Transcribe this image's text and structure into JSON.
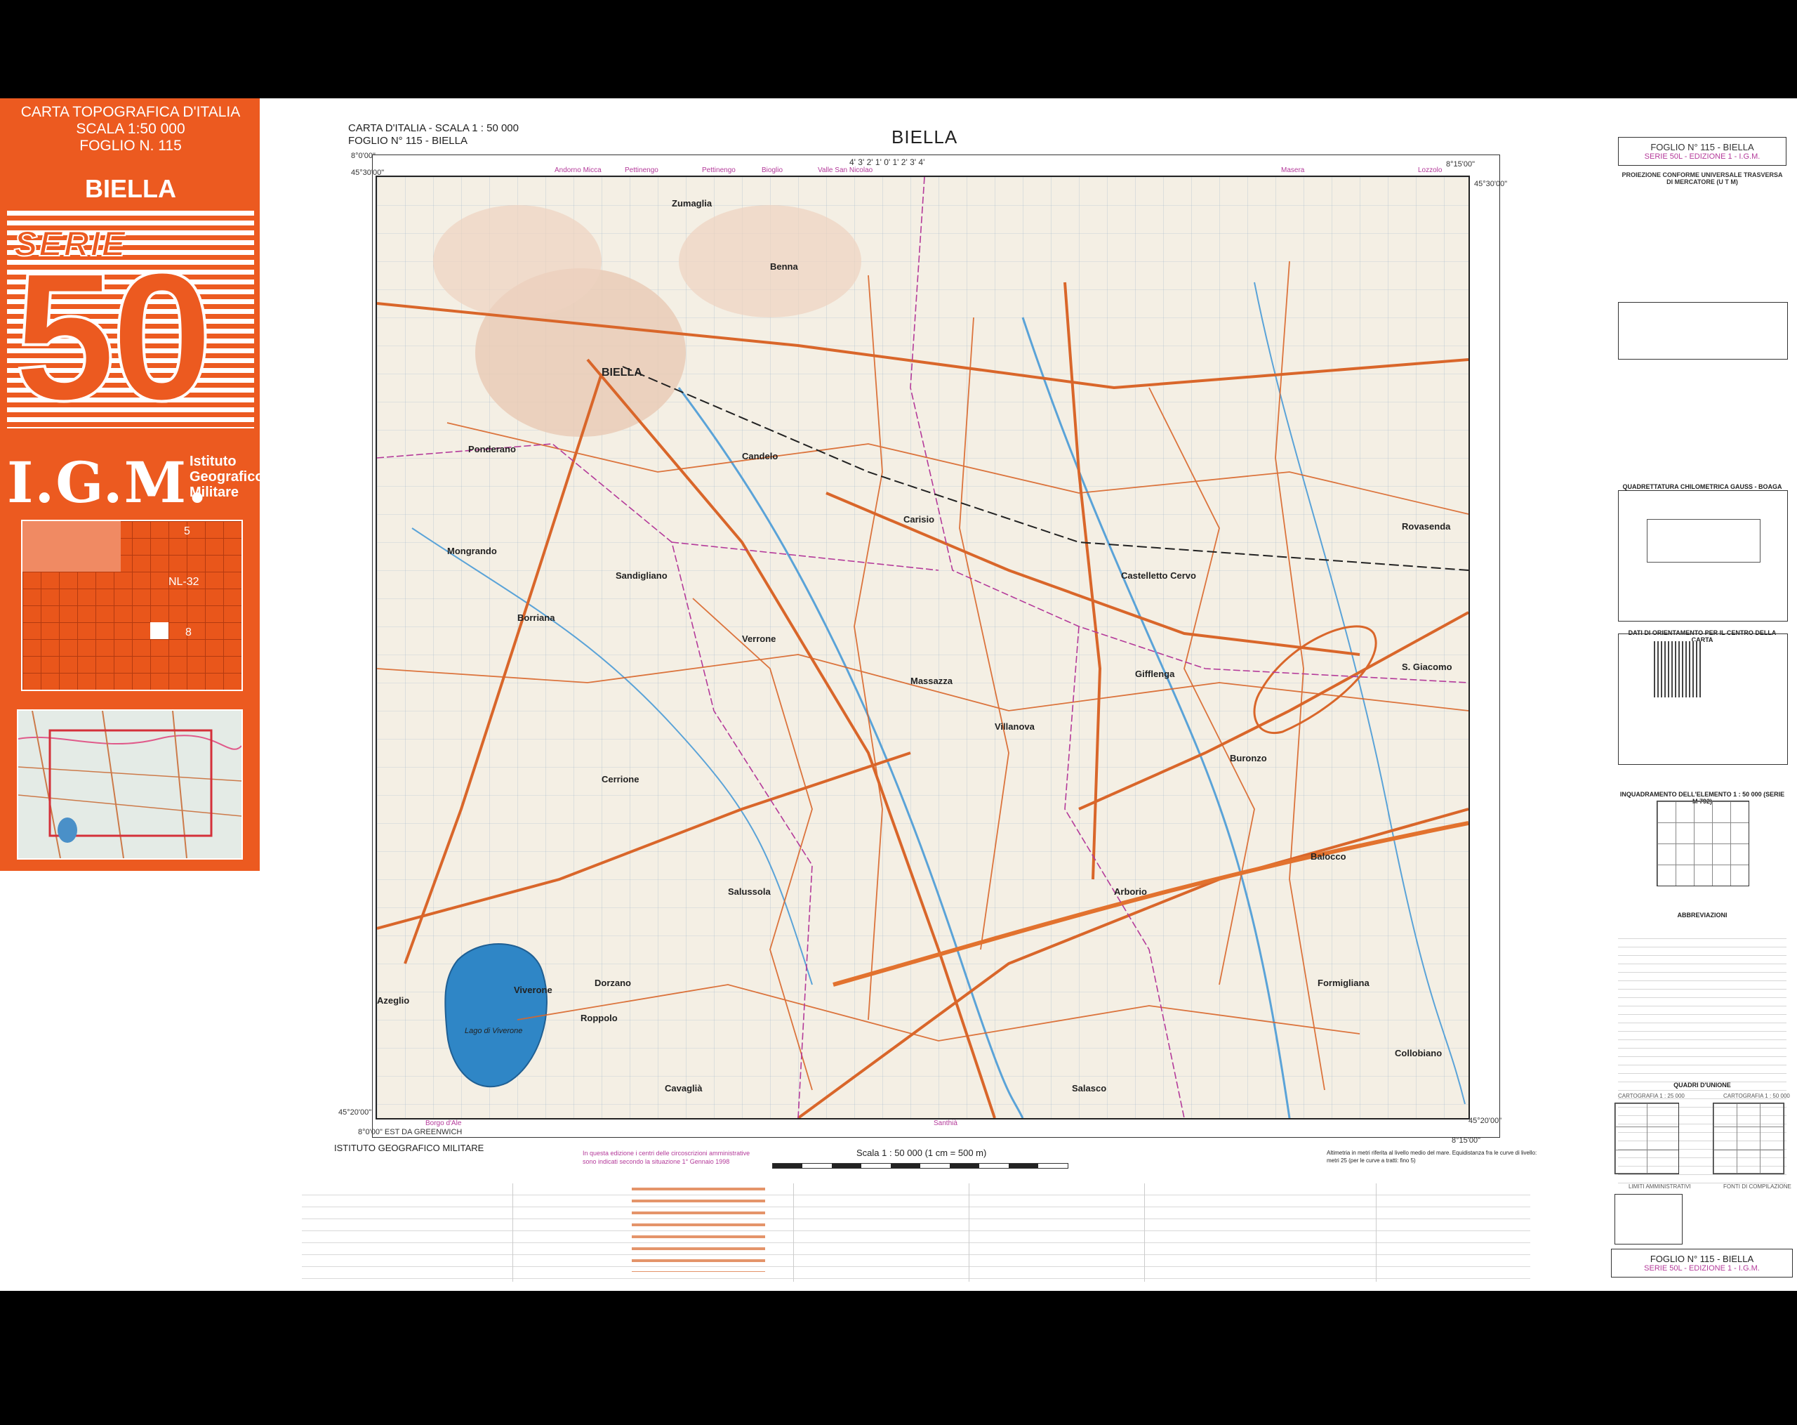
{
  "cover": {
    "line1": "CARTA TOPOGRAFICA D'ITALIA",
    "line2": "SCALA 1:50 000",
    "line3": "FOGLIO N. 115",
    "city": "BIELLA",
    "serie_word": "SERIE",
    "serie_number": "50",
    "logo": "I.G.M.",
    "institute_line1": "Istituto",
    "institute_line2": "Geografico",
    "institute_line3": "Militare",
    "index_label_5": "5",
    "index_label_nl32": "NL-32",
    "index_label_8": "8"
  },
  "header": {
    "left_line1": "CARTA D'ITALIA - SCALA 1 : 50 000",
    "left_line2": "FOGLIO N° 115 - BIELLA",
    "title": "BIELLA"
  },
  "map": {
    "corner_tl_lon": "8°0'00\"",
    "corner_tl_lat": "45°30'00\"",
    "corner_tr_lon": "8°15'00\"",
    "corner_tr_lat": "45°30'00\"",
    "corner_bl_lat": "45°20'00\"",
    "corner_bl_lon": "8°0'00\" EST DA GREENWICH",
    "corner_br_lat": "45°20'00\"",
    "corner_br_lon": "8°15'00\"",
    "top_scale": "4'  3'  2'  1'  0'  1'  2'  3'  4'",
    "edge_labels_top": [
      "Andorno Micca",
      "Pettinengo",
      "Pettinengo",
      "Bioglio",
      "Valle San Nicolao",
      "Masera",
      "Lozzolo"
    ],
    "edge_labels_bottom": [
      "Borgo d'Ale",
      "Santhià"
    ],
    "place_names": [
      "BIELLA",
      "Mongrando",
      "Candelo",
      "Sandigliano",
      "Cerrione",
      "Salussola",
      "Cavaglià",
      "Dorzano",
      "Roppolo",
      "Viverone",
      "Azeglio",
      "Lago di Viverone",
      "Massazza",
      "Villanova",
      "Buronzo",
      "Rovasenda",
      "S. Giacomo",
      "Balocco",
      "Formigliana",
      "Carisio",
      "Arborio",
      "Collobiano",
      "Zumaglia",
      "Ponderano",
      "Borriana",
      "Verrone",
      "Castelletto Cervo",
      "Gifflenga",
      "Benna",
      "Salasco"
    ]
  },
  "right_panel": {
    "title": "FOGLIO N° 115 - BIELLA",
    "subtitle": "SERIE 50L - EDIZIONE 1 - I.G.M.",
    "projection": "PROIEZIONE CONFORME UNIVERSALE TRASVERSA DI MERCATORE (U T M)",
    "quadrettatura": "QUADRETTATURA CHILOMETRICA GAUSS - BOAGA",
    "orientamento": "DATI DI ORIENTAMENTO PER IL CENTRO DELLA CARTA",
    "inquadramento": "INQUADRAMENTO DELL'ELEMENTO 1 : 50 000 (SERIE M 792)",
    "abbreviazioni": "ABBREVIAZIONI",
    "quadri": "QUADRI D'UNIONE",
    "carto25": "CARTOGRAFIA 1 : 25 000",
    "carto50": "CARTOGRAFIA 1 : 50 000",
    "limiti": "LIMITI AMMINISTRATIVI",
    "fonti": "FONTI DI COMPILAZIONE",
    "bottom_title": "FOGLIO N° 115 - BIELLA",
    "bottom_subtitle": "SERIE 50L - EDIZIONE 1 - I.G.M."
  },
  "footer": {
    "institute": "ISTITUTO GEOGRAFICO MILITARE",
    "scale": "Scala 1 : 50 000 (1 cm = 500 m)",
    "note_magenta": "In questa edizione i centri delle circoscrizioni amministrative sono indicati secondo la situazione 1° Gennaio 1998",
    "datum_note": "Altimetria in metri riferita al livello medio del mare. Equidistanza fra le curve di livello: metri 25 (per le curve a tratti: fino 5)"
  },
  "colors": {
    "cover_orange": "#ec5a20",
    "road_orange": "#d9662a",
    "boundary_magenta": "#b43a9a",
    "lake_blue": "#2f86c6",
    "paper": "#f4efe4"
  }
}
